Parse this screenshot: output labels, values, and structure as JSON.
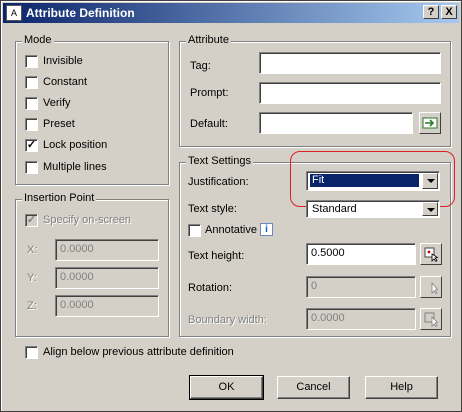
{
  "window": {
    "title": "Attribute Definition",
    "help_btn": "?",
    "close_btn": "X"
  },
  "mode": {
    "title": "Mode",
    "items": [
      {
        "label": "Invisible",
        "checked": false
      },
      {
        "label": "Constant",
        "checked": false
      },
      {
        "label": "Verify",
        "checked": false
      },
      {
        "label": "Preset",
        "checked": false
      },
      {
        "label": "Lock position",
        "checked": true
      },
      {
        "label": "Multiple lines",
        "checked": false
      }
    ]
  },
  "attribute": {
    "title": "Attribute",
    "tag_label": "Tag:",
    "tag_value": "",
    "prompt_label": "Prompt:",
    "prompt_value": "",
    "default_label": "Default:",
    "default_value": ""
  },
  "insertion": {
    "title": "Insertion Point",
    "specify_label": "Specify on-screen",
    "x_label": "X:",
    "x_value": "0.0000",
    "y_label": "Y:",
    "y_value": "0.0000",
    "z_label": "Z:",
    "z_value": "0.0000"
  },
  "text_settings": {
    "title": "Text Settings",
    "justification_label": "Justification:",
    "justification_value": "Fit",
    "style_label": "Text style:",
    "style_value": "Standard",
    "annotative_label": "Annotative",
    "height_label": "Text height:",
    "height_value": "0.5000",
    "rotation_label": "Rotation:",
    "rotation_value": "0",
    "boundary_label": "Boundary width:",
    "boundary_value": "0.0000"
  },
  "align_label": "Align below previous attribute definition",
  "buttons": {
    "ok": "OK",
    "cancel": "Cancel",
    "help": "Help"
  },
  "colors": {
    "accent": "#0a246a",
    "highlight_ring": "#dd2222"
  }
}
